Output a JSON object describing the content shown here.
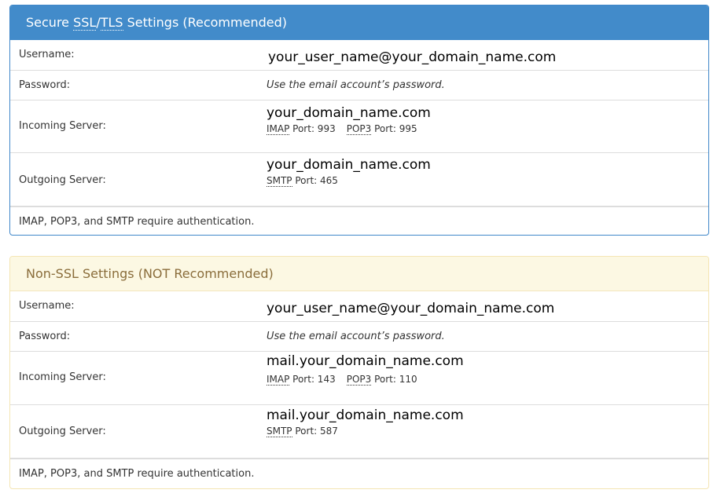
{
  "secure": {
    "title_parts": [
      "Secure ",
      "SSL",
      "/",
      "TLS",
      " Settings (Recommended)"
    ],
    "username_label": "Username:",
    "username_value": "your_user_name@your_domain_name.com",
    "password_label": "Password:",
    "password_value": "Use the email account’s password.",
    "incoming_label": "Incoming Server:",
    "incoming_host": "your_domain_name.com",
    "incoming_imap_abbr": "IMAP",
    "incoming_imap_port": " Port: 993",
    "incoming_pop3_abbr": "POP3",
    "incoming_pop3_port": " Port: 995",
    "outgoing_label": "Outgoing Server:",
    "outgoing_host": "your_domain_name.com",
    "outgoing_smtp_abbr": "SMTP",
    "outgoing_smtp_port": " Port: 465",
    "footer_note": "IMAP, POP3, and SMTP require authentication.",
    "header_color": "#428bca"
  },
  "nonssl": {
    "title": "Non-SSL Settings (NOT Recommended)",
    "username_label": "Username:",
    "username_value": "your_user_name@your_domain_name.com",
    "password_label": "Password:",
    "password_value": "Use the email account’s password.",
    "incoming_label": "Incoming Server:",
    "incoming_host": "mail.your_domain_name.com",
    "incoming_imap_abbr": "IMAP",
    "incoming_imap_port": " Port: 143",
    "incoming_pop3_abbr": "POP3",
    "incoming_pop3_port": " Port: 110",
    "outgoing_label": "Outgoing Server:",
    "outgoing_host": "mail.your_domain_name.com",
    "outgoing_smtp_abbr": "SMTP",
    "outgoing_smtp_port": " Port: 587",
    "footer_note": "IMAP, POP3, and SMTP require authentication.",
    "header_color": "#fcf8e3"
  }
}
